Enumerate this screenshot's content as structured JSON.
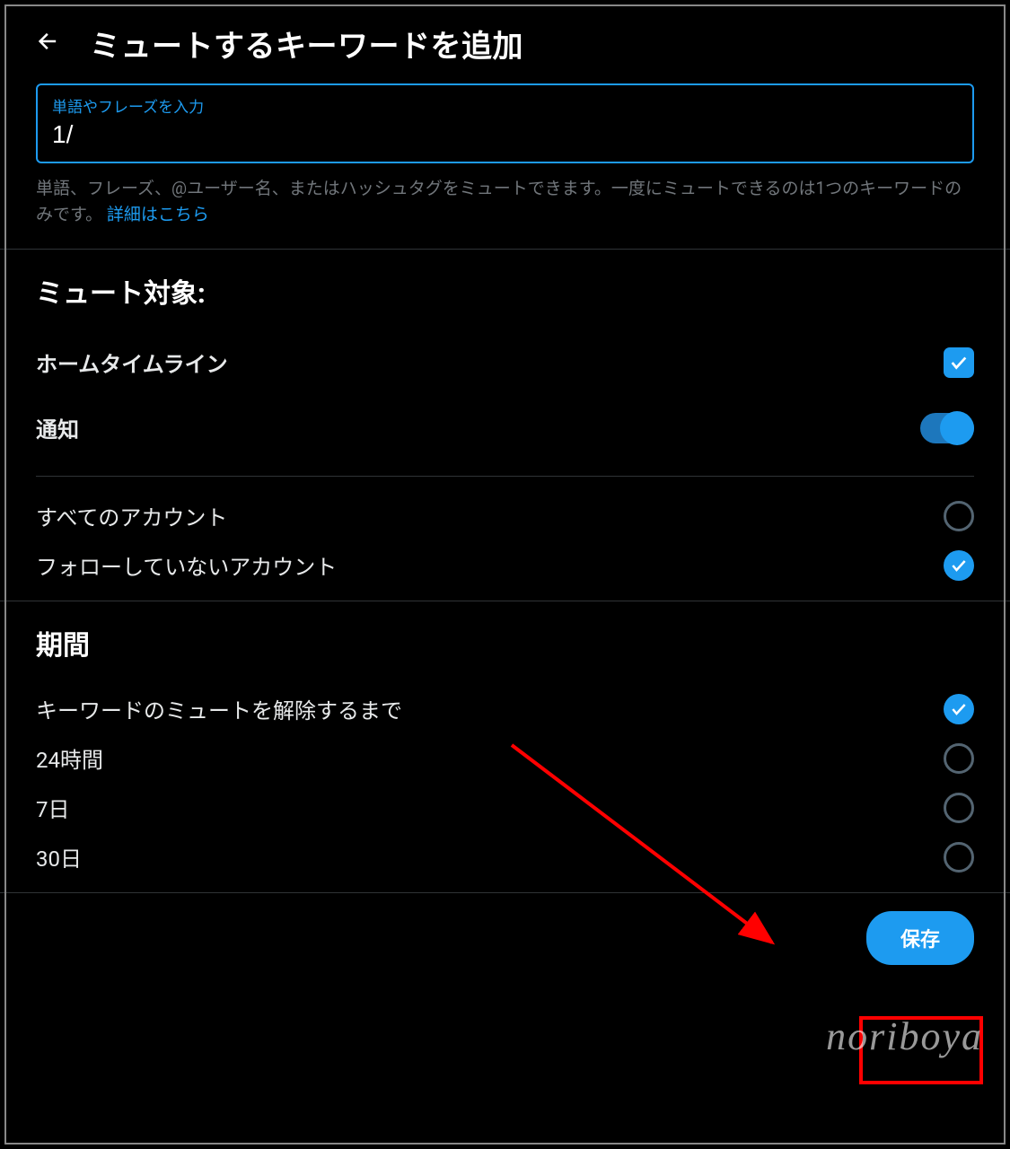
{
  "header": {
    "title": "ミュートするキーワードを追加"
  },
  "input": {
    "label": "単語やフレーズを入力",
    "value": "1/"
  },
  "help": {
    "text_before": "単語、フレーズ、@ユーザー名、またはハッシュタグをミュートできます。一度にミュートできるのは1つのキーワードのみです。",
    "link": "詳細はこちら"
  },
  "mute_target": {
    "title": "ミュート対象:",
    "options": {
      "home_timeline": "ホームタイムライン",
      "notifications": "通知"
    },
    "accounts": {
      "all": "すべてのアカウント",
      "not_following": "フォローしていないアカウント"
    }
  },
  "duration": {
    "title": "期間",
    "options": {
      "until_unmute": "キーワードのミュートを解除するまで",
      "h24": "24時間",
      "d7": "7日",
      "d30": "30日"
    }
  },
  "footer": {
    "save": "保存"
  },
  "watermark": "noriboya",
  "colors": {
    "accent": "#1d9bf0",
    "highlight": "#ff0000"
  }
}
